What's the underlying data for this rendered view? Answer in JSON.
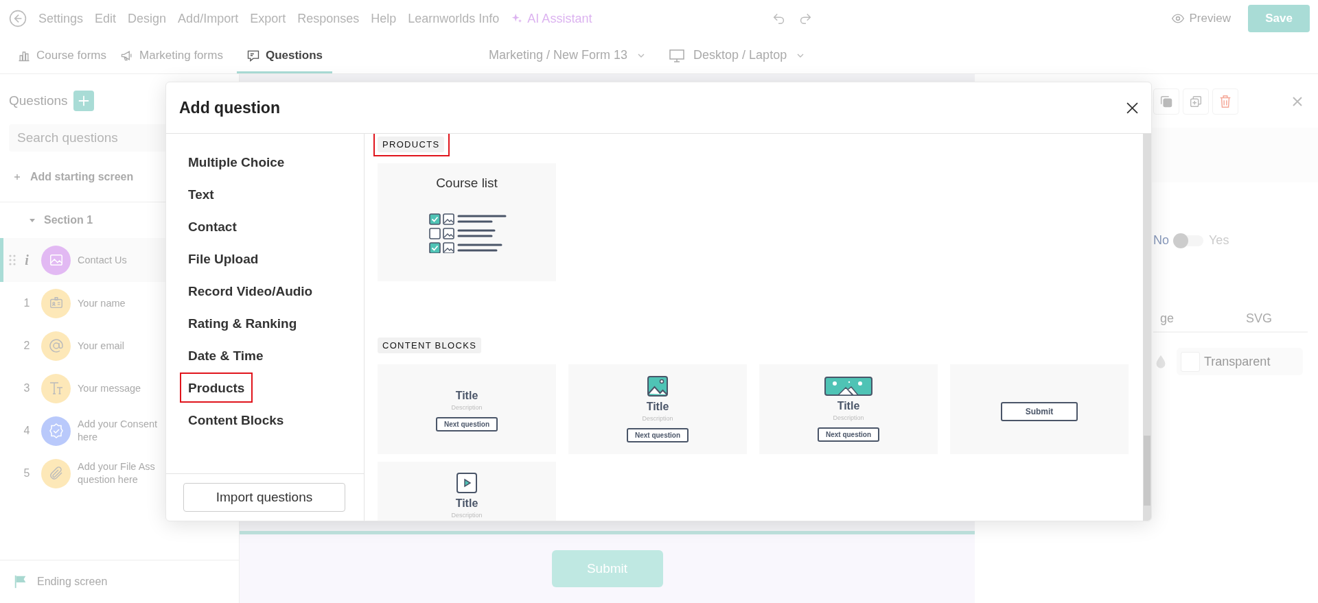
{
  "menu_bar": {
    "items": [
      "Settings",
      "Edit",
      "Design",
      "Add/Import",
      "Export",
      "Responses",
      "Help",
      "Learnworlds Info"
    ],
    "ai_assistant": "AI Assistant",
    "preview": "Preview",
    "save": "Save"
  },
  "tabs": [
    {
      "label": "Course forms",
      "selected": false
    },
    {
      "label": "Marketing forms",
      "selected": false
    },
    {
      "label": "Questions",
      "selected": true
    }
  ],
  "form_selector": "Marketing / New Form 13",
  "device_selector": "Desktop / Laptop",
  "sidebar": {
    "title": "Questions",
    "search_placeholder": "Search questions",
    "add_starting_screen": "Add starting screen",
    "section": {
      "label": "Section 1",
      "expanded": true
    },
    "questions": [
      {
        "kind": "info",
        "number": "i",
        "label": "Contact Us",
        "color": "#e2b9f3",
        "selected": true
      },
      {
        "kind": "numbered",
        "number": "1",
        "label": "Your name",
        "color": "#fde8b8",
        "selected": false
      },
      {
        "kind": "numbered",
        "number": "2",
        "label": "Your email",
        "color": "#fde8b8",
        "selected": false
      },
      {
        "kind": "numbered",
        "number": "3",
        "label": "Your message",
        "color": "#fde8b8",
        "selected": false
      },
      {
        "kind": "numbered",
        "number": "4",
        "label": "Add your Consent\nhere",
        "color": "#b9c9fb",
        "selected": false
      },
      {
        "kind": "numbered",
        "number": "5",
        "label": "Add your File Ass\nquestion here",
        "color": "#fde8b8",
        "selected": false
      }
    ],
    "ending_screen": "Ending screen"
  },
  "canvas": {
    "submit": "Submit"
  },
  "right_panel": {
    "toggle": {
      "off_label": "No",
      "on_label": "Yes",
      "on": false
    },
    "tabs": [
      "ge",
      "SVG"
    ],
    "background": {
      "label": "Transparent",
      "checked": false
    }
  },
  "dialog": {
    "title": "Add question",
    "categories": [
      {
        "label": "Multiple Choice",
        "highlighted": false
      },
      {
        "label": "Text",
        "highlighted": false
      },
      {
        "label": "Contact",
        "highlighted": false
      },
      {
        "label": "File Upload",
        "highlighted": false
      },
      {
        "label": "Record Video/Audio",
        "highlighted": false
      },
      {
        "label": "Rating & Ranking",
        "highlighted": false
      },
      {
        "label": "Date & Time",
        "highlighted": false
      },
      {
        "label": "Products",
        "highlighted": true
      },
      {
        "label": "Content Blocks",
        "highlighted": false
      }
    ],
    "import_button": "Import questions",
    "sections": [
      {
        "label": "PRODUCTS",
        "highlighted": true,
        "cards": [
          {
            "kind": "course_list",
            "title": "Course list"
          }
        ]
      },
      {
        "label": "CONTENT BLOCKS",
        "highlighted": false,
        "cards": [
          {
            "kind": "text_block",
            "title": "Title",
            "description": "Description",
            "button": "Next question"
          },
          {
            "kind": "image_block",
            "title": "Title",
            "description": "Description",
            "button": "Next question"
          },
          {
            "kind": "banner_block",
            "title": "Title",
            "description": "Description",
            "button": "Next question"
          },
          {
            "kind": "submit_block",
            "button": "Submit"
          },
          {
            "kind": "video_block",
            "title": "Title",
            "description": "Description"
          }
        ]
      }
    ]
  }
}
